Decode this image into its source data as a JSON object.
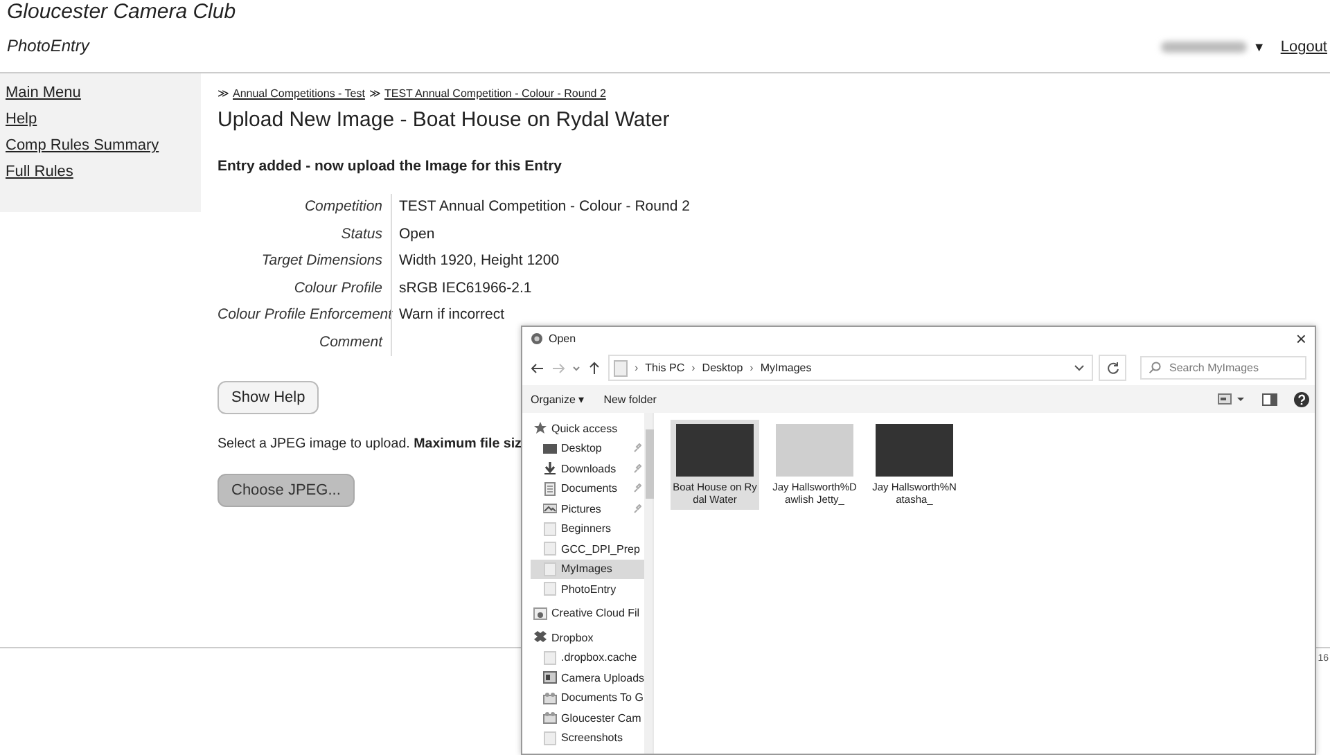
{
  "header": {
    "title": "Gloucester Camera Club",
    "subtitle": "PhotoEntry",
    "user_menu": {
      "caret": "▼"
    },
    "logout": "Logout"
  },
  "sidebar": {
    "items": [
      {
        "label": "Main Menu"
      },
      {
        "label": "Help"
      },
      {
        "label": "Comp Rules Summary"
      },
      {
        "label": "Full Rules"
      }
    ]
  },
  "breadcrumb": [
    {
      "kind": "separator",
      "text": "≫"
    },
    {
      "kind": "link",
      "text": "Annual Competitions - Test"
    },
    {
      "kind": "separator",
      "text": "≫"
    },
    {
      "kind": "link",
      "text": "TEST Annual Competition - Colour - Round 2"
    }
  ],
  "heading": "Upload New Image - Boat House on Rydal Water",
  "message": "Entry added - now upload the Image for this Entry",
  "details": [
    {
      "label": "Competition",
      "value": "TEST Annual Competition - Colour - Round 2"
    },
    {
      "label": "Status",
      "value": "Open"
    },
    {
      "label": "Target Dimensions",
      "value": "Width 1920, Height 1200"
    },
    {
      "label": "Colour Profile",
      "value": "sRGB IEC61966-2.1"
    },
    {
      "label": "Colour Profile Enforcement",
      "value": "Warn if incorrect"
    },
    {
      "label": "Comment"
    }
  ],
  "show_help_button": "Show Help",
  "instruction": "Select a JPEG image to upload. **Maximum file siz**",
  "choose_button": {
    "label": "Choose JPEG...",
    "disabled": true
  },
  "footer": {
    "text": "16"
  },
  "dialog": {
    "title": "Open",
    "close": "×",
    "address": [
      {
        "kind": "separator",
        "text": "›"
      },
      {
        "kind": "crumb",
        "text": "This PC"
      },
      {
        "kind": "separator",
        "text": "›"
      },
      {
        "kind": "crumb",
        "text": "Desktop"
      },
      {
        "kind": "separator",
        "text": "›"
      },
      {
        "kind": "crumb",
        "text": "MyImages"
      }
    ],
    "search": {
      "placeholder": "Search MyImages"
    },
    "toolbar": {
      "organize": "Organize ▾",
      "new_folder": "New folder"
    },
    "nav": [
      {
        "label": "Quick access",
        "kind": "star",
        "children": [
          {
            "label": "Desktop",
            "kind": "desktop",
            "pinned": true,
            "selected": false
          },
          {
            "label": "Downloads",
            "kind": "download",
            "pinned": true,
            "selected": false
          },
          {
            "label": "Documents",
            "kind": "document",
            "pinned": true,
            "selected": false
          },
          {
            "label": "Pictures",
            "kind": "picture",
            "pinned": true,
            "selected": false
          },
          {
            "label": "Beginners",
            "kind": "folder",
            "pinned": false,
            "selected": false
          },
          {
            "label": "GCC_DPI_Prep",
            "kind": "folder",
            "pinned": false,
            "selected": false
          },
          {
            "label": "MyImages",
            "kind": "folder",
            "pinned": false,
            "selected": true
          },
          {
            "label": "PhotoEntry",
            "kind": "folder",
            "pinned": false,
            "selected": false
          }
        ]
      },
      {
        "label": "Creative Cloud Fil",
        "kind": "cloud"
      },
      {
        "label": "Dropbox",
        "kind": "dropbox",
        "children": [
          {
            "label": ".dropbox.cache",
            "kind": "folder",
            "pinned": false,
            "selected": false
          },
          {
            "label": "Camera Uploads",
            "kind": "camera",
            "pinned": false,
            "selected": false
          },
          {
            "label": "Documents To G",
            "kind": "shared",
            "pinned": false,
            "selected": false
          },
          {
            "label": "Gloucester Cam",
            "kind": "shared",
            "pinned": false,
            "selected": false
          },
          {
            "label": "Screenshots",
            "kind": "folder",
            "pinned": false,
            "selected": false
          }
        ]
      }
    ],
    "files": [
      {
        "name": "Boat House on Rydal Water",
        "selected": true,
        "kind": "dark"
      },
      {
        "name": "Jay Hallsworth%Dawlish Jetty_",
        "selected": false,
        "kind": "light"
      },
      {
        "name": "Jay Hallsworth%Natasha_",
        "selected": false,
        "kind": "dark"
      }
    ]
  }
}
